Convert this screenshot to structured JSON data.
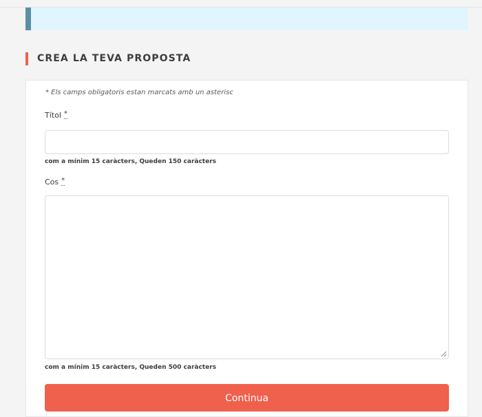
{
  "section": {
    "title": "CREA LA TEVA PROPOSTA"
  },
  "form": {
    "required_note": "* Els camps obligatoris estan marcats amb un asterisc",
    "title_field": {
      "label": "Títol",
      "required_mark": "*",
      "value": "",
      "helper": "com a mínim 15 caràcters, Queden 150 caràcters"
    },
    "body_field": {
      "label": "Cos",
      "required_mark": "*",
      "value": "",
      "helper": "com a mínim 15 caràcters, Queden 500 caràcters"
    },
    "submit_label": "Continua"
  },
  "colors": {
    "accent": "#ef604d",
    "callout_bg": "#e1f5fe",
    "callout_bar": "#5b8fa3"
  }
}
